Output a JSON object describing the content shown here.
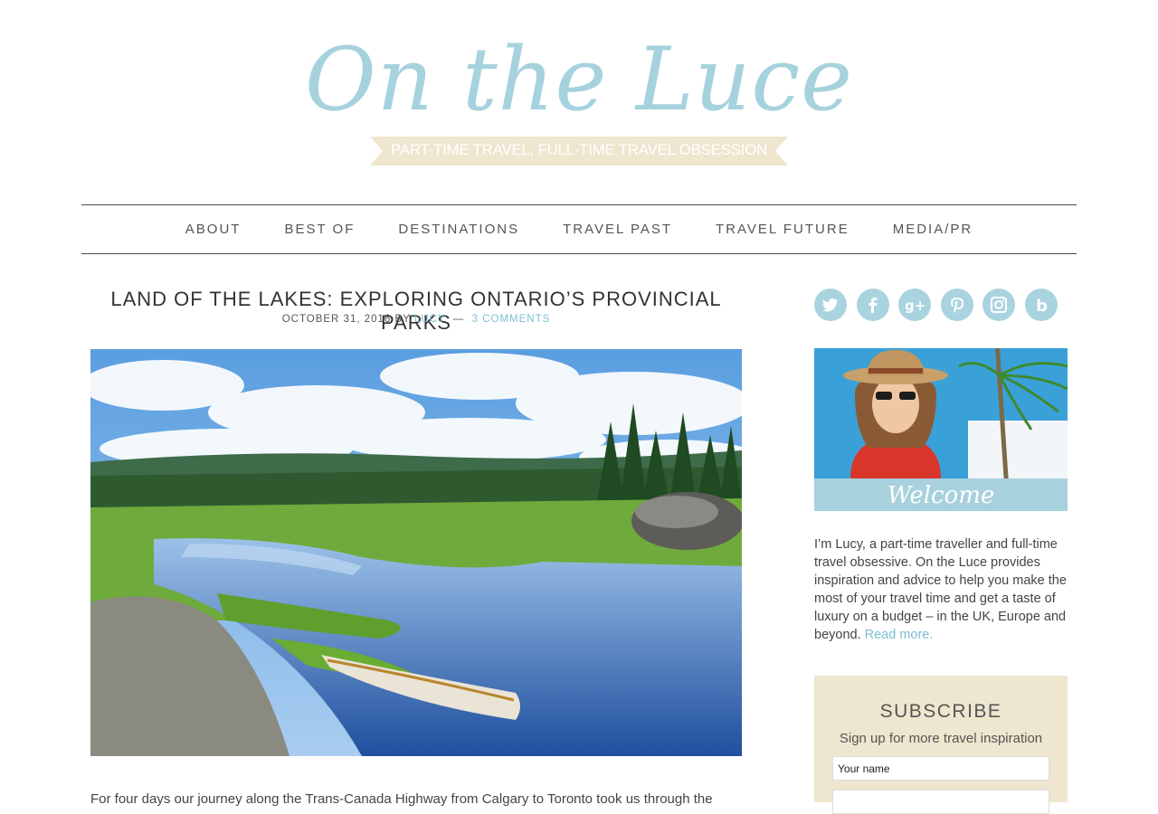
{
  "header": {
    "logo_text": "On the Luce",
    "tagline": "PART-TIME TRAVEL, FULL-TIME TRAVEL OBSESSION",
    "accent_color": "#a6d2dd",
    "ribbon_color": "#efe6cf"
  },
  "nav": {
    "items": [
      {
        "label": "ABOUT"
      },
      {
        "label": "BEST OF"
      },
      {
        "label": "DESTINATIONS"
      },
      {
        "label": "TRAVEL PAST"
      },
      {
        "label": "TRAVEL FUTURE"
      },
      {
        "label": "MEDIA/PR"
      }
    ]
  },
  "post": {
    "title": "LAND OF THE LAKES: EXPLORING ONTARIO’S PROVINCIAL PARKS",
    "date": "OCTOBER 31, 2016",
    "by": "BY",
    "author": "LUCY",
    "separator": "—",
    "comments": "3 COMMENTS",
    "excerpt": "For four days our journey along the Trans-Canada Highway from Calgary to Toronto took us through the"
  },
  "sidebar": {
    "social_icons": [
      "twitter-icon",
      "facebook-icon",
      "google-plus-icon",
      "pinterest-icon",
      "instagram-icon",
      "bloglovin-icon"
    ],
    "welcome_label": "Welcome",
    "bio": "I’m Lucy, a part-time traveller and full-time travel obsessive. On the Luce provides inspiration and advice to help you make the most of your travel time and get a taste of luxury on a budget – in the UK, Europe and beyond.",
    "read_more": "Read more.",
    "subscribe": {
      "title": "SUBSCRIBE",
      "subtitle": "Sign up for more travel inspiration",
      "name_placeholder": "Your name",
      "email_placeholder": ""
    }
  }
}
